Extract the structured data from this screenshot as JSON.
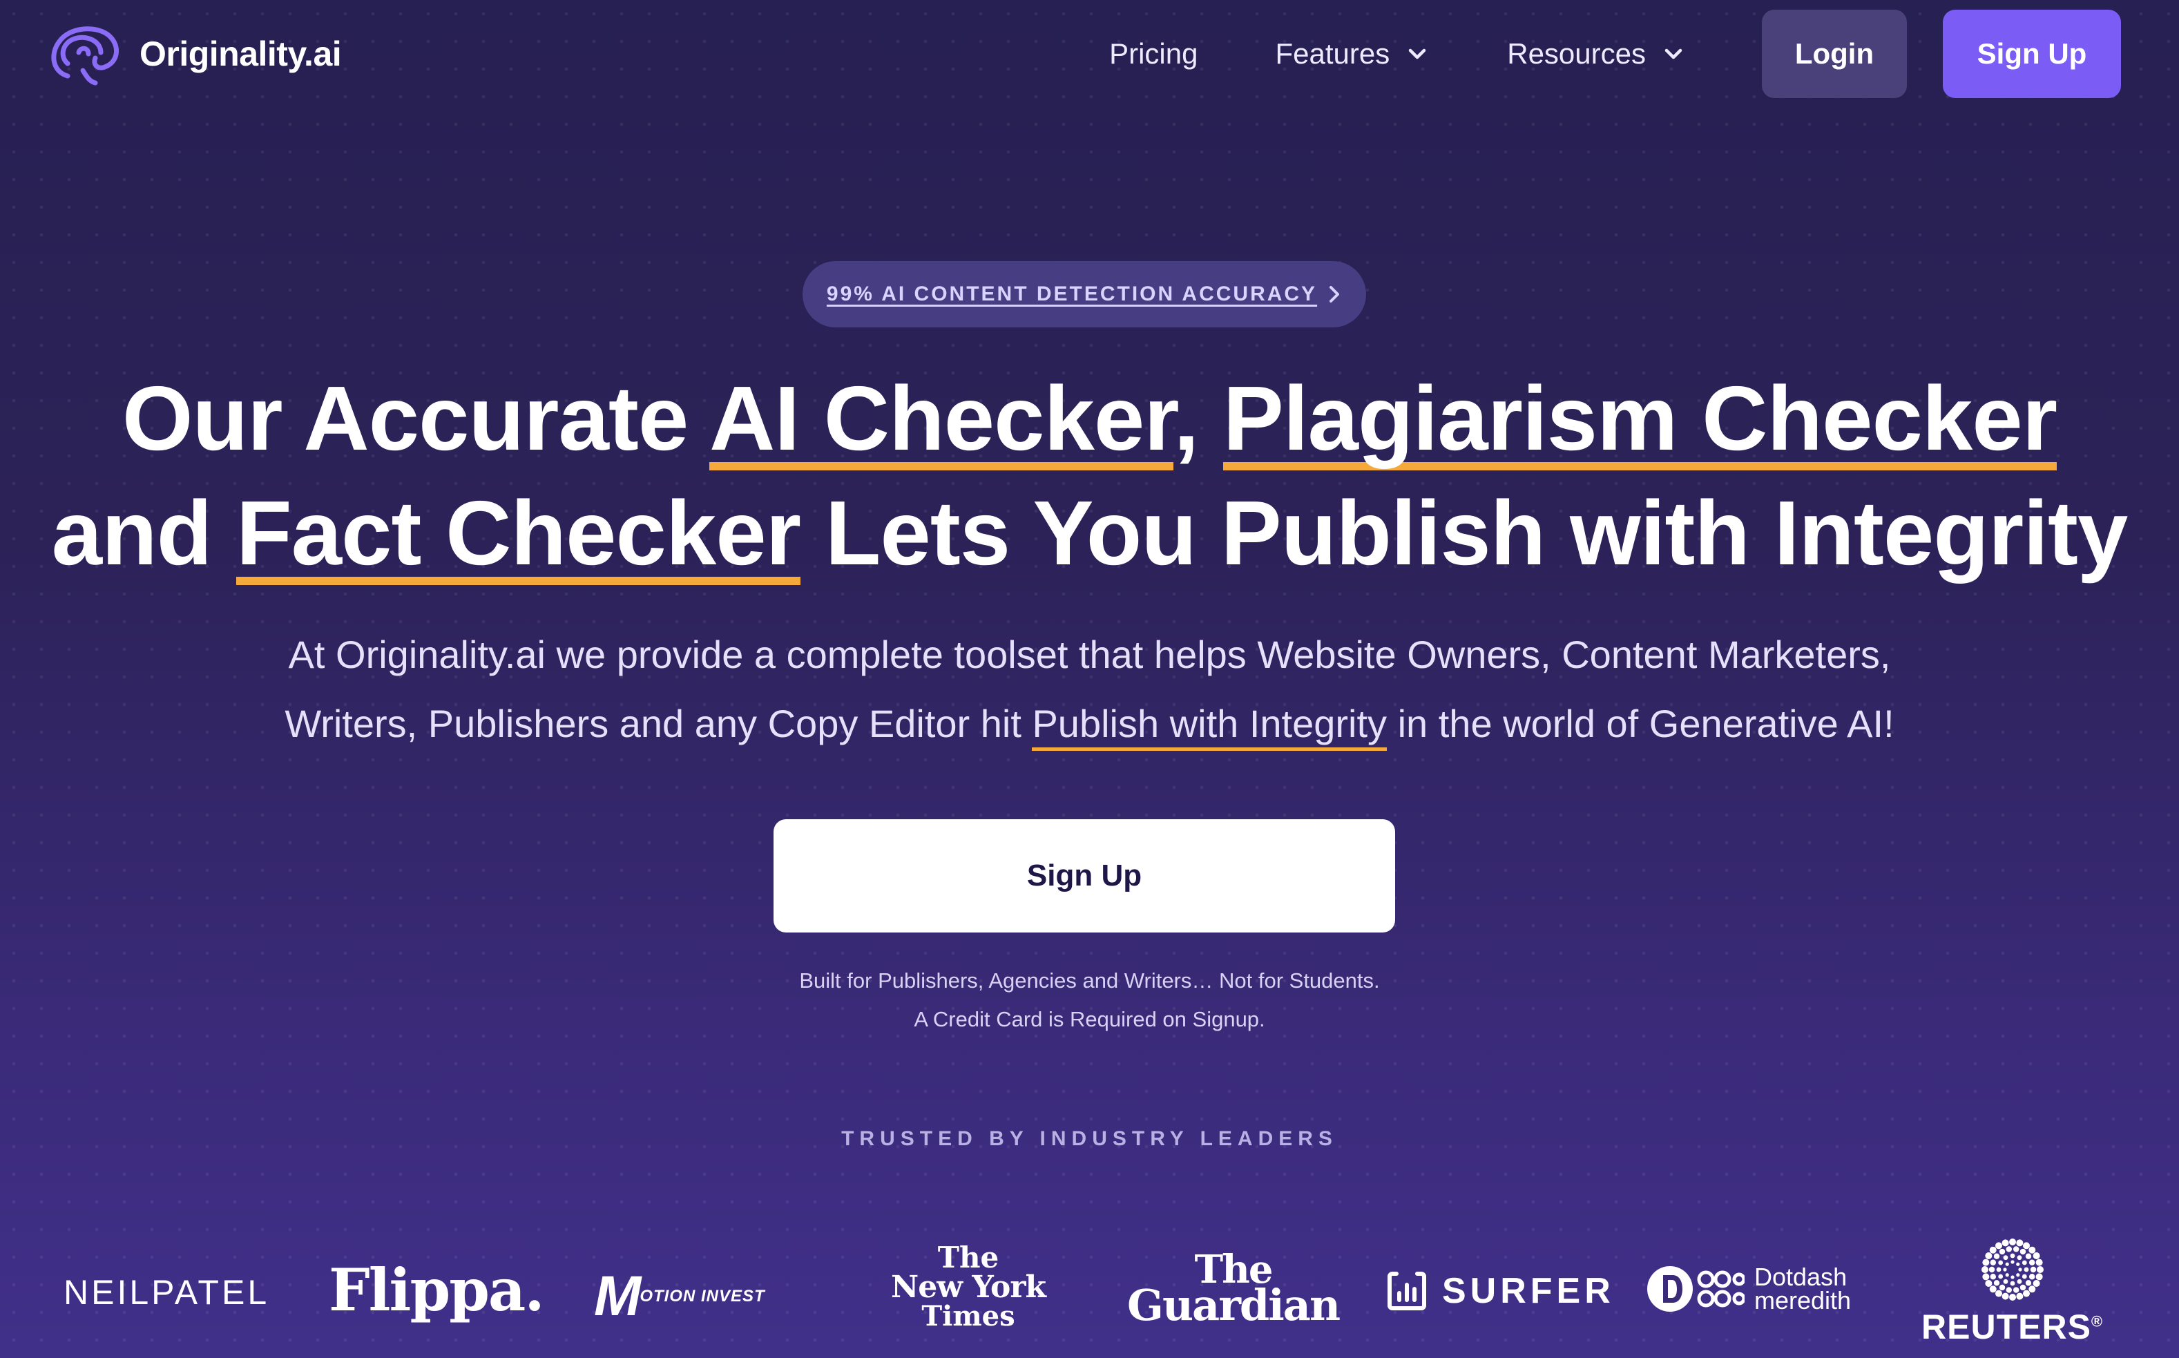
{
  "header": {
    "brand_name": "Originality.ai",
    "nav": {
      "pricing": "Pricing",
      "features": "Features",
      "resources": "Resources"
    },
    "login_label": "Login",
    "signup_label": "Sign Up"
  },
  "hero": {
    "badge": "99% AI CONTENT DETECTION ACCURACY",
    "headline": {
      "l1_a": "Our Accurate ",
      "l1_b": "AI Checker",
      "l1_c": ", ",
      "l1_d": "Plagiarism Checker",
      "l2_a": "and ",
      "l2_b": "Fact Checker",
      "l2_c": " Lets You Publish with Integrity"
    },
    "subtitle": {
      "line1": "At Originality.ai we provide a complete toolset that helps Website Owners, Content Marketers,",
      "line2_a": "Writers, Publishers and any Copy Editor hit ",
      "line2_link": "Publish with Integrity",
      "line2_b": " in the world of Generative AI!"
    },
    "cta_label": "Sign Up",
    "note_line1": "Built for Publishers, Agencies and Writers… Not for Students.",
    "note_line2": "A Credit Card is Required on Signup."
  },
  "trusted": {
    "heading": "TRUSTED BY INDUSTRY LEADERS",
    "logos": {
      "neilpatel": "NEILPATEL",
      "flippa": "Flippa.",
      "motion_mark": "M",
      "motion_text": "OTION INVEST",
      "nyt_1": "The",
      "nyt_2": "New York",
      "nyt_3": "Times",
      "guardian_1": "The",
      "guardian_2": "Guardian",
      "surfer": "SURFER",
      "dotdash_1": "Dotdash",
      "dotdash_2": "meredith",
      "reuters": "REUTERS",
      "reuters_mark": "®"
    }
  },
  "colors": {
    "background": "#2a2256",
    "accent": "#7b5cf5",
    "underline": "#f4a93a",
    "login_bg": "#4a417a",
    "badge_bg": "#463d82"
  }
}
